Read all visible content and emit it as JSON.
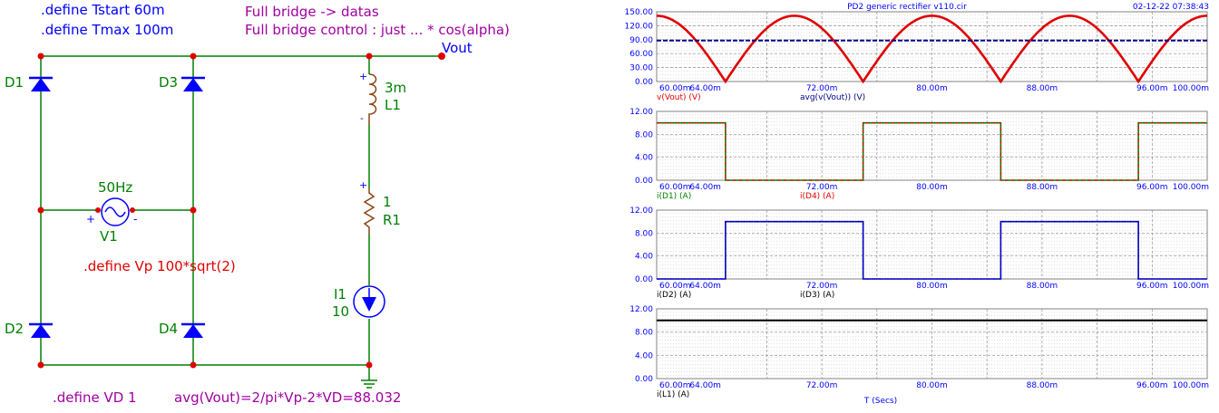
{
  "schematic": {
    "defines_top": [
      ".define Tstart 60m",
      ".define Tmax 100m"
    ],
    "notes_top": [
      "Full bridge -> datas",
      "Full bridge control : just  ... * cos(alpha)"
    ],
    "vout_label": "Vout",
    "diodes": [
      "D1",
      "D3",
      "D2",
      "D4"
    ],
    "source_freq": "50Hz",
    "source_name": "V1",
    "source_plus": "+",
    "source_minus": "-",
    "vp_define": ".define Vp 100*sqrt(2)",
    "inductor_value": "3m",
    "inductor_name": "L1",
    "resistor_value": "1",
    "resistor_name": "R1",
    "current_name": "I1",
    "current_value": "10",
    "plus_sign": "+",
    "minus_sign": "-",
    "vd_define": ".define VD 1",
    "avg_formula": "avg(Vout)=2/pi*Vp-2*VD=88.032",
    "colors": {
      "green": "#008000",
      "red": "#e00000",
      "blue": "#0000ff",
      "purple": "#a000a0",
      "navy": "#00008b"
    }
  },
  "plots": {
    "title": "PD2 generic rectifier v110.cir",
    "timestamp": "02-12-22 07:38:43",
    "x_axis_label": "T (Secs)",
    "x_tick_labels": [
      "60.00m",
      "64.00m",
      "72.00m",
      "80.00m",
      "88.00m",
      "96.00m",
      "100.00m"
    ],
    "panels": [
      {
        "y_ticks": [
          "150.00",
          "120.00",
          "90.00",
          "60.00",
          "30.00",
          "0.00"
        ],
        "legend": [
          {
            "text": "v(Vout) (V)",
            "color": "#e00000"
          },
          {
            "text": "avg(v(Vout)) (V)",
            "color": "#00008b"
          }
        ]
      },
      {
        "y_ticks": [
          "12.00",
          "8.00",
          "4.00",
          "0.00"
        ],
        "legend": [
          {
            "text": "i(D1) (A)",
            "color": "#008000"
          },
          {
            "text": "i(D4) (A)",
            "color": "#e00000"
          }
        ]
      },
      {
        "y_ticks": [
          "12.00",
          "8.00",
          "4.00",
          "0.00"
        ],
        "legend": [
          {
            "text": "i(D2) (A)",
            "color": "#000000"
          },
          {
            "text": "i(D3) (A)",
            "color": "#000000"
          }
        ]
      },
      {
        "y_ticks": [
          "12.00",
          "8.00",
          "4.00",
          "0.00"
        ],
        "legend": [
          {
            "text": "i(L1) (A)",
            "color": "#000000"
          }
        ]
      }
    ]
  },
  "chart_data": [
    {
      "type": "line",
      "x_range_ms": [
        60,
        100
      ],
      "ylim": [
        0,
        150
      ],
      "series": [
        {
          "name": "v(Vout) (V)",
          "color": "#e00000",
          "function": "abs_sine",
          "amplitude": 141.42,
          "frequency_hz": 50,
          "zero_crossings_ms": [
            65,
            75,
            85,
            95
          ]
        },
        {
          "name": "avg(v(Vout)) (V)",
          "color": "#00008b",
          "constant": 88.03
        }
      ]
    },
    {
      "type": "line",
      "x_range_ms": [
        60,
        100
      ],
      "ylim": [
        0,
        12
      ],
      "series": [
        {
          "name": "i(D1) (A)",
          "color": "#008000",
          "high_value": 10,
          "high_intervals_ms": [
            [
              60,
              65
            ],
            [
              75,
              85
            ],
            [
              95,
              100
            ]
          ]
        },
        {
          "name": "i(D4) (A)",
          "color": "#e00000",
          "high_value": 10,
          "high_intervals_ms": [
            [
              60,
              65
            ],
            [
              75,
              85
            ],
            [
              95,
              100
            ]
          ]
        }
      ]
    },
    {
      "type": "line",
      "x_range_ms": [
        60,
        100
      ],
      "ylim": [
        0,
        12
      ],
      "series": [
        {
          "name": "i(D2) (A)",
          "color": "#00008b",
          "high_value": 10,
          "high_intervals_ms": [
            [
              65,
              75
            ],
            [
              85,
              95
            ]
          ]
        },
        {
          "name": "i(D3) (A)",
          "color": "#0000ff",
          "high_value": 10,
          "high_intervals_ms": [
            [
              65,
              75
            ],
            [
              85,
              95
            ]
          ]
        }
      ]
    },
    {
      "type": "line",
      "x_range_ms": [
        60,
        100
      ],
      "ylim": [
        0,
        12
      ],
      "series": [
        {
          "name": "i(L1) (A)",
          "color": "#000000",
          "constant": 10
        }
      ]
    }
  ]
}
